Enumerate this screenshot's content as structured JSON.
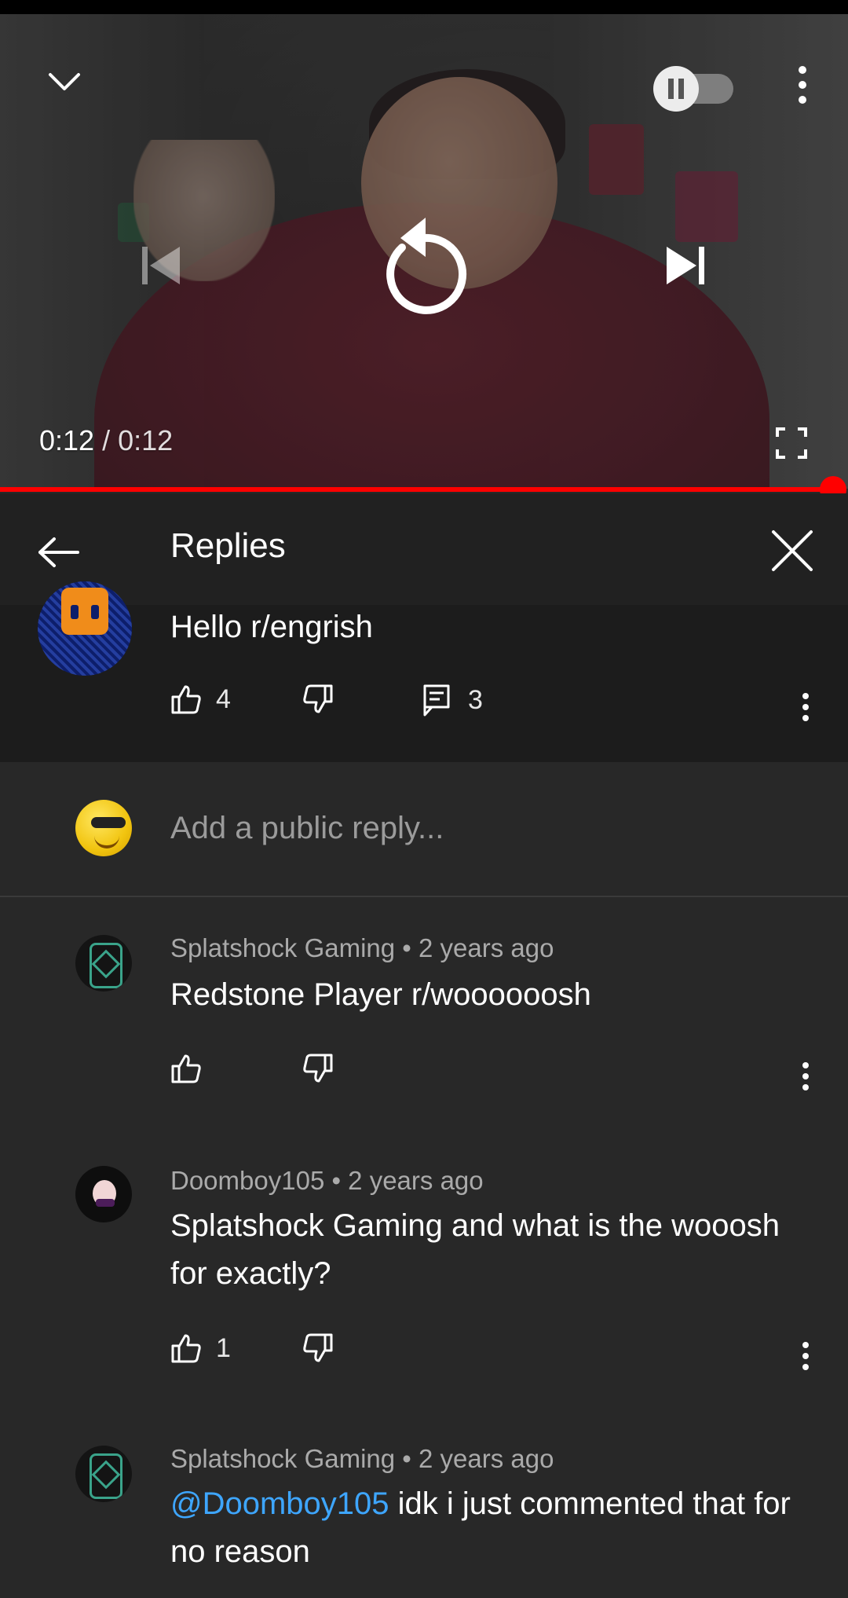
{
  "video": {
    "current_time": "0:12",
    "separator": "/",
    "duration": "0:12",
    "progress": 1.0,
    "accent_color": "#ff0000"
  },
  "panel": {
    "title": "Replies"
  },
  "parent_comment": {
    "text": "Hello r/engrish",
    "likes": "4",
    "reply_count": "3"
  },
  "add_reply": {
    "placeholder": "Add a public reply..."
  },
  "replies": [
    {
      "meta": "Splatshock Gaming • 2 years ago",
      "text": "Redstone Player r/woooooosh",
      "likes": ""
    },
    {
      "meta": "Doomboy105 • 2 years ago",
      "text": "Splatshock Gaming and what is the wooosh for exactly?",
      "likes": "1"
    },
    {
      "meta": "Splatshock Gaming • 2 years ago",
      "mention": "@Doomboy105",
      "text": " idk i just commented that for no reason",
      "likes": ""
    }
  ],
  "icons": {
    "collapse": "chevron-down-icon",
    "autoplay": "autoplay-toggle",
    "more": "more-vert-icon",
    "previous": "skip-previous-icon",
    "replay": "replay-icon",
    "next": "skip-next-icon",
    "fullscreen": "fullscreen-icon",
    "back": "arrow-back-icon",
    "close": "close-icon",
    "like": "thumb-up-icon",
    "dislike": "thumb-down-icon",
    "comment": "comment-icon"
  }
}
